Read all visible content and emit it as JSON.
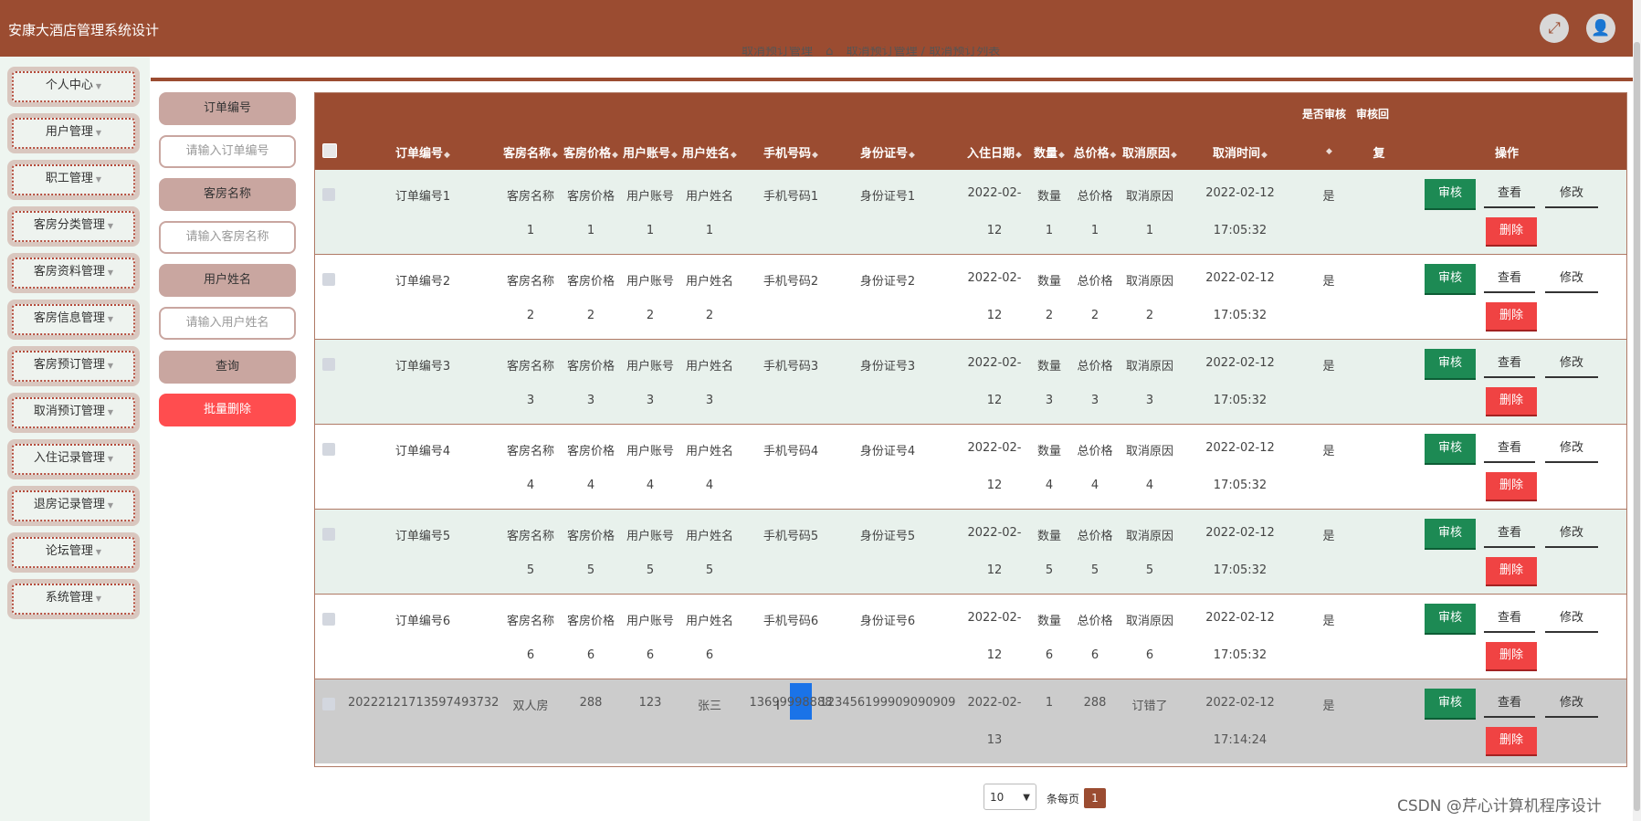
{
  "app": {
    "title": "安康大酒店管理系统设计"
  },
  "header_icons": [
    "fullscreen-icon",
    "user-icon"
  ],
  "sidebar": {
    "items": [
      {
        "label": "个人中心"
      },
      {
        "label": "用户管理"
      },
      {
        "label": "职工管理"
      },
      {
        "label": "客房分类管理"
      },
      {
        "label": "客房资料管理"
      },
      {
        "label": "客房信息管理"
      },
      {
        "label": "客房预订管理"
      },
      {
        "label": "取消预订管理"
      },
      {
        "label": "入住记录管理"
      },
      {
        "label": "退房记录管理"
      },
      {
        "label": "论坛管理"
      },
      {
        "label": "系统管理"
      }
    ]
  },
  "breadcrumb": {
    "page": "取消预订管理",
    "home_icon": "home-icon",
    "path": "取消预订管理 / 取消预订列表"
  },
  "filters": {
    "order_label": "订单编号",
    "order_placeholder": "请输入订单编号",
    "room_label": "客房名称",
    "room_placeholder": "请输入客房名称",
    "user_label": "用户姓名",
    "user_placeholder": "请输入用户姓名",
    "search_button": "查询",
    "batch_delete_button": "批量删除"
  },
  "table": {
    "header_top": {
      "audit_status": "是否审核",
      "audit_reply": "审核回"
    },
    "headers": {
      "order_no": "订单编号",
      "room_name": "客房名称",
      "room_price": "客房价格",
      "user_account": "用户账号",
      "user_name": "用户姓名",
      "phone": "手机号码",
      "id_card": "身份证号",
      "checkin_date": "入住日期",
      "quantity": "数量",
      "total_price": "总价格",
      "cancel_reason": "取消原因",
      "cancel_time": "取消时间",
      "reply_cont": "复",
      "actions": "操作"
    },
    "rows": [
      {
        "order_no": "订单编号1",
        "room_name_1": "客房名称",
        "room_name_2": "1",
        "room_price_1": "客房价格",
        "room_price_2": "1",
        "user_account_1": "用户账号",
        "user_account_2": "1",
        "user_name_1": "用户姓名",
        "user_name_2": "1",
        "phone": "手机号码1",
        "id_card": "身份证号1",
        "date_1": "2022-02-",
        "date_2": "12",
        "qty_1": "数量",
        "qty_2": "1",
        "total_1": "总价格",
        "total_2": "1",
        "reason_1": "取消原因",
        "reason_2": "1",
        "time_1": "2022-02-12",
        "time_2": "17:05:32",
        "audited": "是"
      },
      {
        "order_no": "订单编号2",
        "room_name_1": "客房名称",
        "room_name_2": "2",
        "room_price_1": "客房价格",
        "room_price_2": "2",
        "user_account_1": "用户账号",
        "user_account_2": "2",
        "user_name_1": "用户姓名",
        "user_name_2": "2",
        "phone": "手机号码2",
        "id_card": "身份证号2",
        "date_1": "2022-02-",
        "date_2": "12",
        "qty_1": "数量",
        "qty_2": "2",
        "total_1": "总价格",
        "total_2": "2",
        "reason_1": "取消原因",
        "reason_2": "2",
        "time_1": "2022-02-12",
        "time_2": "17:05:32",
        "audited": "是"
      },
      {
        "order_no": "订单编号3",
        "room_name_1": "客房名称",
        "room_name_2": "3",
        "room_price_1": "客房价格",
        "room_price_2": "3",
        "user_account_1": "用户账号",
        "user_account_2": "3",
        "user_name_1": "用户姓名",
        "user_name_2": "3",
        "phone": "手机号码3",
        "id_card": "身份证号3",
        "date_1": "2022-02-",
        "date_2": "12",
        "qty_1": "数量",
        "qty_2": "3",
        "total_1": "总价格",
        "total_2": "3",
        "reason_1": "取消原因",
        "reason_2": "3",
        "time_1": "2022-02-12",
        "time_2": "17:05:32",
        "audited": "是"
      },
      {
        "order_no": "订单编号4",
        "room_name_1": "客房名称",
        "room_name_2": "4",
        "room_price_1": "客房价格",
        "room_price_2": "4",
        "user_account_1": "用户账号",
        "user_account_2": "4",
        "user_name_1": "用户姓名",
        "user_name_2": "4",
        "phone": "手机号码4",
        "id_card": "身份证号4",
        "date_1": "2022-02-",
        "date_2": "12",
        "qty_1": "数量",
        "qty_2": "4",
        "total_1": "总价格",
        "total_2": "4",
        "reason_1": "取消原因",
        "reason_2": "4",
        "time_1": "2022-02-12",
        "time_2": "17:05:32",
        "audited": "是"
      },
      {
        "order_no": "订单编号5",
        "room_name_1": "客房名称",
        "room_name_2": "5",
        "room_price_1": "客房价格",
        "room_price_2": "5",
        "user_account_1": "用户账号",
        "user_account_2": "5",
        "user_name_1": "用户姓名",
        "user_name_2": "5",
        "phone": "手机号码5",
        "id_card": "身份证号5",
        "date_1": "2022-02-",
        "date_2": "12",
        "qty_1": "数量",
        "qty_2": "5",
        "total_1": "总价格",
        "total_2": "5",
        "reason_1": "取消原因",
        "reason_2": "5",
        "time_1": "2022-02-12",
        "time_2": "17:05:32",
        "audited": "是"
      },
      {
        "order_no": "订单编号6",
        "room_name_1": "客房名称",
        "room_name_2": "6",
        "room_price_1": "客房价格",
        "room_price_2": "6",
        "user_account_1": "用户账号",
        "user_account_2": "6",
        "user_name_1": "用户姓名",
        "user_name_2": "6",
        "phone": "手机号码6",
        "id_card": "身份证号6",
        "date_1": "2022-02-",
        "date_2": "12",
        "qty_1": "数量",
        "qty_2": "6",
        "total_1": "总价格",
        "total_2": "6",
        "reason_1": "取消原因",
        "reason_2": "6",
        "time_1": "2022-02-12",
        "time_2": "17:05:32",
        "audited": "是"
      },
      {
        "order_no": "20222121713597493732",
        "room_name_1": "双人房",
        "room_name_2": "",
        "room_price_1": "288",
        "room_price_2": "",
        "user_account_1": "123",
        "user_account_2": "",
        "user_name_1": "张三",
        "user_name_2": "",
        "phone": "13699998888",
        "id_card": "123456199909090909",
        "date_1": "2022-02-",
        "date_2": "13",
        "qty_1": "1",
        "qty_2": "",
        "total_1": "288",
        "total_2": "",
        "reason_1": "订错了",
        "reason_2": "",
        "time_1": "2022-02-12",
        "time_2": "17:14:24",
        "audited": "是"
      }
    ],
    "action_labels": {
      "audit": "审核",
      "view": "查看",
      "edit": "修改",
      "delete": "删除"
    }
  },
  "pagination": {
    "page_size": "10",
    "per_page_label": "条每页",
    "current_page": "1"
  },
  "watermark": "CSDN @芹心计算机程序设计"
}
